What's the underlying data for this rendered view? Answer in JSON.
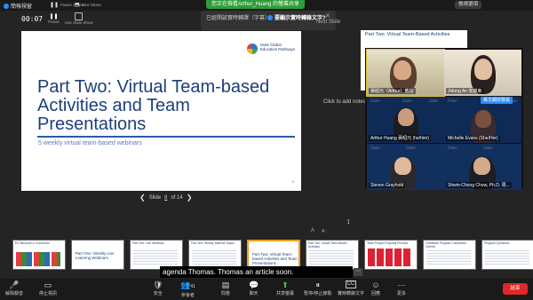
{
  "topbar": {
    "app_label": "簡報視窗",
    "pause_label": "Pause Share",
    "new_share_label": "New Share",
    "zoom_banner": "您正在檢看Arthur_Huang 的螢幕共享",
    "view_options": "檢視選項"
  },
  "timer": {
    "elapsed": "00:07",
    "pause_lbl": "Pause",
    "slide_show_lbl": "Use Slide Show"
  },
  "caption_popup": {
    "text1": "已經開啟實時轉譯（字幕）",
    "text2": "要顯示實時轉錄文字?",
    "close": "✕"
  },
  "presenter_view": {
    "next_slide_label": "Next Slide",
    "add_notes_label": "Click to add notes",
    "slide_counter_prefix": "Slide",
    "slide_counter_current": "8",
    "slide_counter_of": "of 14",
    "ctrl_a": "A",
    "ctrl_b": "A⁻"
  },
  "slide": {
    "logo_text": "Duke Global Education Pathways",
    "title": "Part Two: Virtual Team-based Activities and Team Presentations",
    "subtitle": "5 weekly virtual team-based webinars",
    "page_number": "8"
  },
  "next_slide": {
    "title": "Part Two: Virtual Team-Based Activities"
  },
  "gallery": {
    "participants": [
      {
        "name": "黃昭元（Arthur）教授",
        "active": true
      },
      {
        "name": "Jidong An 安繼東",
        "active": false
      },
      {
        "name": "Arthur Huang 黃昭元 (he/him)",
        "active": false
      },
      {
        "name": "Michelle Evans (She/Her)",
        "active": false
      },
      {
        "name": "Steven Grayhold",
        "active": false
      },
      {
        "name": "Shwin-Chong Chow, Ph.D. 周...",
        "active": false
      }
    ],
    "share_tag": "黃文顯財務長",
    "duke_word": "Duke"
  },
  "filmstrip": [
    {
      "heading": "ES Structure & Curriculum"
    },
    {
      "heading": "Part One: Weekly Live Learning Webinars"
    },
    {
      "heading": "Part One: Live Webinars"
    },
    {
      "heading": "Part One: Weekly Material Topics"
    },
    {
      "heading": "Part Two: Virtual Team-based Activities and Team Presentations",
      "current": true
    },
    {
      "heading": "Part Two: Virtual Team-Based Activities"
    },
    {
      "heading": "Team Project Proposal Process"
    },
    {
      "heading": "Certificate Program Completion Criteria"
    },
    {
      "heading": "Program Questions"
    }
  ],
  "caption": {
    "text": "agenda Thomas. Thomas an article soon.",
    "ctrl": "⋯"
  },
  "toolbar": {
    "items": [
      {
        "icon": "🎤",
        "label": "解除靜音"
      },
      {
        "icon": "▭",
        "label": "停止視訊"
      },
      {
        "icon": "🛡",
        "label": "安全"
      },
      {
        "icon": "👥",
        "label": "參會者",
        "count": "41"
      },
      {
        "icon": "▤",
        "label": "問卷"
      },
      {
        "icon": "💬",
        "label": "聊天"
      },
      {
        "icon": "⬆",
        "label": "共享螢幕"
      },
      {
        "icon": "⏸",
        "label": "暫停/停止錄製"
      },
      {
        "icon": "CC",
        "label": "實時轉錄文字"
      },
      {
        "icon": "☺",
        "label": "回應"
      },
      {
        "icon": "⋯",
        "label": "更多"
      }
    ],
    "end_label": "結束"
  }
}
